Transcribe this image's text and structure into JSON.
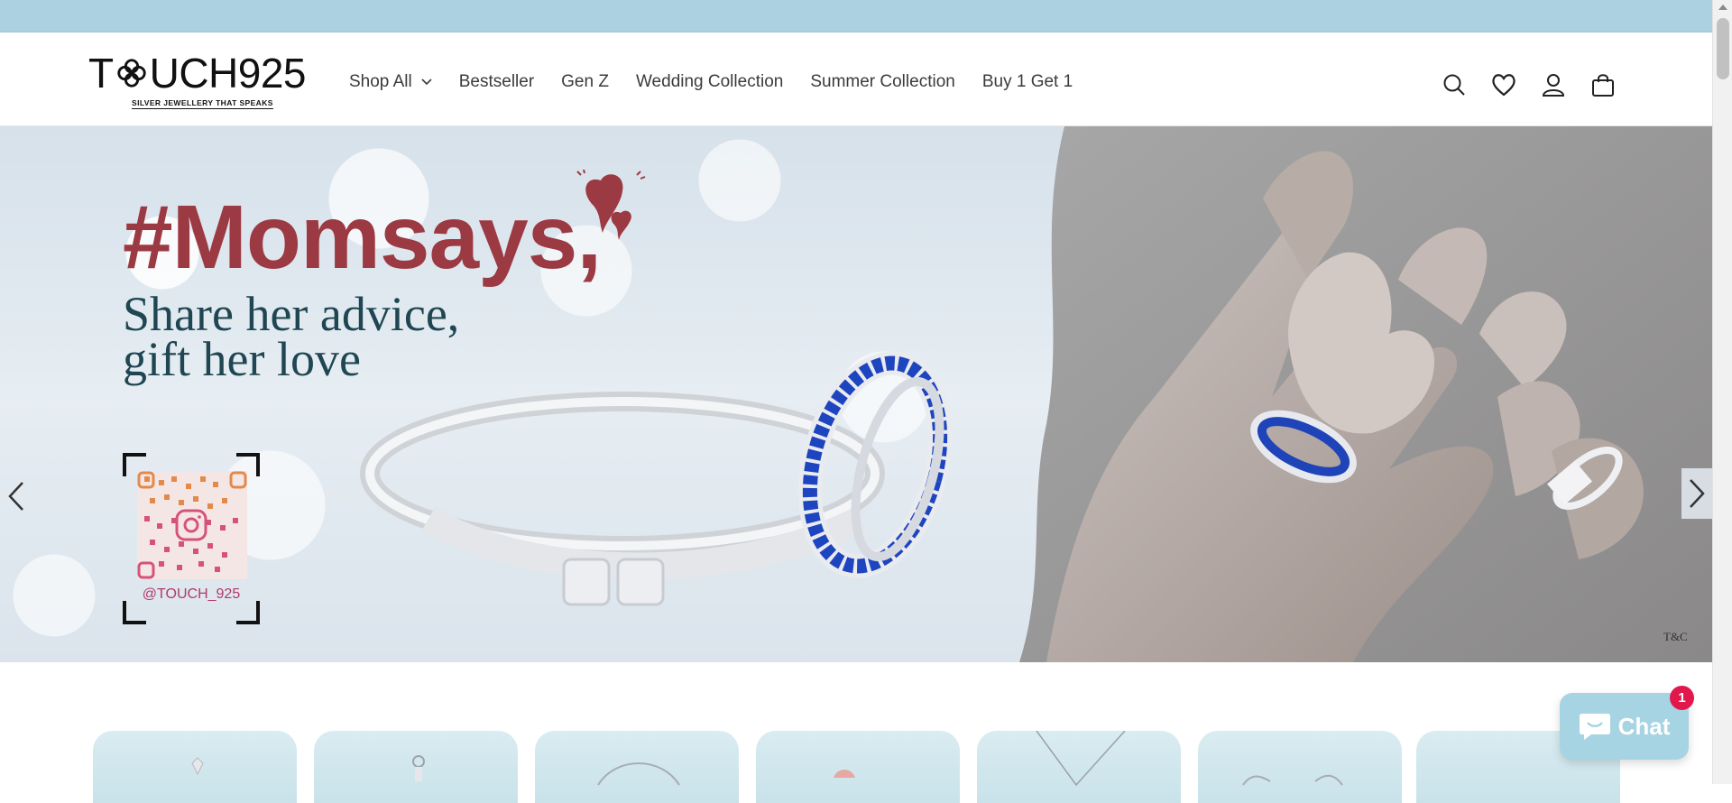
{
  "header": {
    "logo": {
      "name": "TOUCH925",
      "tagline": "SILVER JEWELLERY THAT SPEAKS"
    },
    "nav": [
      {
        "label": "Shop All",
        "has_dropdown": true
      },
      {
        "label": "Bestseller"
      },
      {
        "label": "Gen Z"
      },
      {
        "label": "Wedding Collection"
      },
      {
        "label": "Summer Collection"
      },
      {
        "label": "Buy 1 Get 1"
      }
    ],
    "icons": [
      "search-icon",
      "heart-icon",
      "user-icon",
      "cart-icon"
    ]
  },
  "hero": {
    "headline": "#Momsays,",
    "subheadline_line1": "Share her advice,",
    "subheadline_line2": "gift her love",
    "instagram_handle": "@TOUCH_925",
    "terms": "T&C",
    "colors": {
      "headline": "#9c3a43",
      "subheadline": "#1f4652"
    }
  },
  "categories": {
    "visible_cards": 7
  },
  "chat": {
    "label": "Chat",
    "badge": "1",
    "color": "#a7d4e3"
  },
  "colors": {
    "announcement_bar": "#acd2e1"
  }
}
